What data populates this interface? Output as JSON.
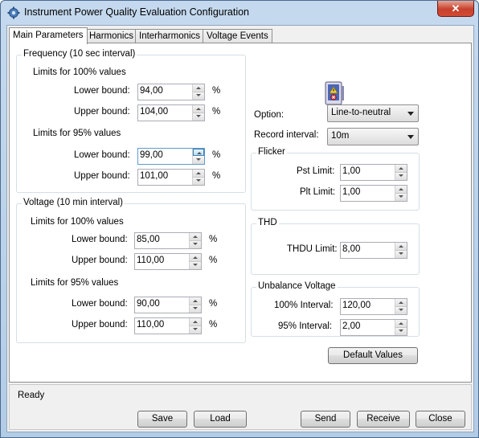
{
  "window": {
    "title": "Instrument Power Quality Evaluation Configuration",
    "close_glyph": "✕"
  },
  "tabs": [
    "Main Parameters",
    "Harmonics",
    "Interharmonics",
    "Voltage Events"
  ],
  "frequency": {
    "title": "Frequency (10 sec interval)",
    "limits100": {
      "heading": "Limits for 100% values",
      "lower_label": "Lower bound:",
      "lower": "94,00",
      "upper_label": "Upper bound:",
      "upper": "104,00",
      "unit": "%"
    },
    "limits95": {
      "heading": "Limits for 95% values",
      "lower_label": "Lower bound:",
      "lower": "99,00",
      "upper_label": "Upper bound:",
      "upper": "101,00",
      "unit": "%"
    }
  },
  "voltage": {
    "title": "Voltage (10 min interval)",
    "limits100": {
      "heading": "Limits for 100% values",
      "lower_label": "Lower bound:",
      "lower": "85,00",
      "upper_label": "Upper bound:",
      "upper": "110,00",
      "unit": "%"
    },
    "limits95": {
      "heading": "Limits for 95% values",
      "lower_label": "Lower bound:",
      "lower": "90,00",
      "upper_label": "Upper bound:",
      "upper": "110,00",
      "unit": "%"
    }
  },
  "option": {
    "label": "Option:",
    "value": "Line-to-neutral"
  },
  "record_interval": {
    "label": "Record interval:",
    "value": "10m"
  },
  "flicker": {
    "title": "Flicker",
    "pst_label": "Pst Limit:",
    "pst": "1,00",
    "plt_label": "Plt Limit:",
    "plt": "1,00"
  },
  "thd": {
    "title": "THD",
    "thdu_label": "THDU Limit:",
    "thdu": "8,00"
  },
  "unbalance": {
    "title": "Unbalance Voltage",
    "i100_label": "100% Interval:",
    "i100": "120,00",
    "i95_label": "95% Interval:",
    "i95": "2,00"
  },
  "buttons": {
    "default_values": "Default Values",
    "save": "Save",
    "load": "Load",
    "send": "Send",
    "receive": "Receive",
    "close": "Close"
  },
  "status": {
    "text": "Ready"
  },
  "colors": {
    "title_bar": "#b9d1ea",
    "close_button": "#c7402c",
    "group_border": "#d5dfe5",
    "client_bg": "#f0f0f0"
  }
}
